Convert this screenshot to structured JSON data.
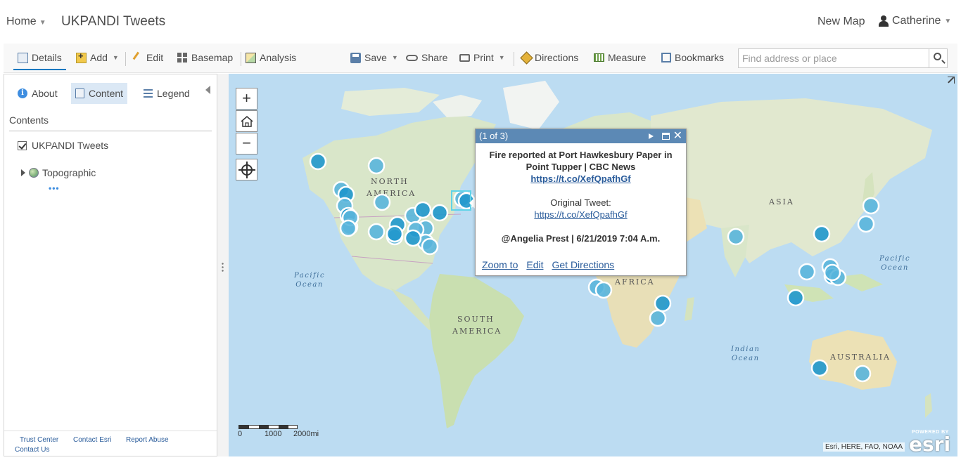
{
  "topbar": {
    "home_label": "Home",
    "map_title": "UKPANDI Tweets",
    "new_map_label": "New Map",
    "user_name": "Catherine"
  },
  "toolbar": {
    "details": "Details",
    "add": "Add",
    "edit": "Edit",
    "basemap": "Basemap",
    "analysis": "Analysis",
    "save": "Save",
    "share": "Share",
    "print": "Print",
    "directions": "Directions",
    "measure": "Measure",
    "bookmarks": "Bookmarks",
    "search_placeholder": "Find address or place"
  },
  "sidepanel": {
    "tabs": {
      "about": "About",
      "content": "Content",
      "legend": "Legend"
    },
    "contents_heading": "Contents",
    "layers": [
      {
        "name": "UKPANDI Tweets",
        "checked": true
      },
      {
        "name": "Topographic"
      }
    ],
    "more": "•••",
    "footer": {
      "trust_center": "Trust Center",
      "contact_esri": "Contact Esri",
      "report_abuse": "Report Abuse",
      "contact_us": "Contact Us"
    }
  },
  "map": {
    "labels": {
      "north_america": [
        "NORTH",
        "AMERICA"
      ],
      "south_america": [
        "SOUTH",
        "AMERICA"
      ],
      "africa": "AFRICA",
      "asia": "ASIA",
      "australia": "AUSTRALIA",
      "pacific_left": [
        "Pacific",
        "Ocean"
      ],
      "pacific_right": [
        "Pacific",
        "Ocean"
      ],
      "indian": [
        "Indian",
        "Ocean"
      ]
    },
    "scale": {
      "zero": "0",
      "mid": "1000",
      "end": "2000mi"
    },
    "attribution": "Esri, HERE, FAO, NOAA",
    "esri_powered": "POWERED BY",
    "esri_logo": "esri"
  },
  "popup": {
    "counter": "(1 of 3)",
    "title_text": "Fire reported at Port Hawkesbury Paper in Point Tupper | CBC News ",
    "title_link": "https://t.co/XefQpafhGf",
    "original_label": "Original Tweet:",
    "original_link": "https://t.co/XefQpafhGf",
    "author_line": "@Angelia Prest | 6/21/2019 7:04 A.m.",
    "actions": {
      "zoom": "Zoom to",
      "edit": "Edit",
      "directions": "Get Directions"
    }
  },
  "colors": {
    "accent": "#0079c1",
    "marker": "#2b9fd0",
    "popup_header": "#5c89b5",
    "link": "#2a5c9b"
  }
}
